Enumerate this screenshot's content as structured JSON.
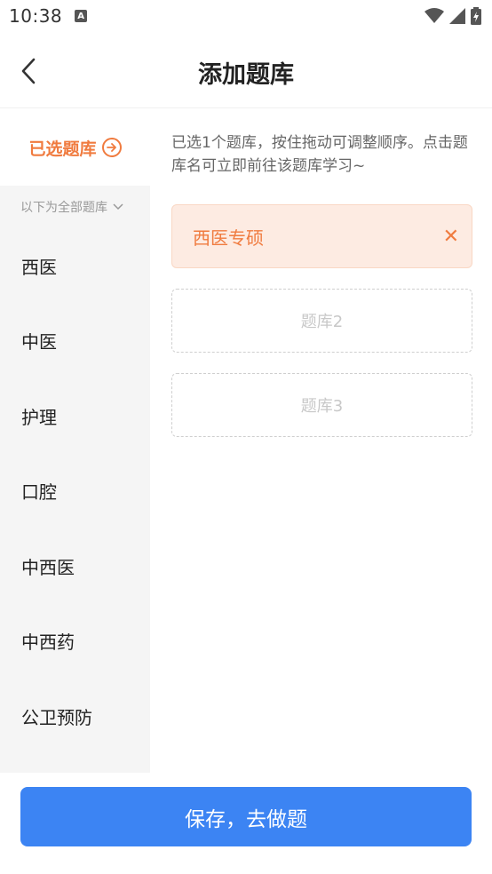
{
  "status_bar": {
    "time": "10:38",
    "notification_badge": "A"
  },
  "header": {
    "title": "添加题库"
  },
  "sidebar": {
    "selected_label": "已选题库",
    "all_label": "以下为全部题库",
    "items": [
      {
        "label": "西医"
      },
      {
        "label": "中医"
      },
      {
        "label": "护理"
      },
      {
        "label": "口腔"
      },
      {
        "label": "中西医"
      },
      {
        "label": "中西药"
      },
      {
        "label": "公卫预防"
      }
    ]
  },
  "main": {
    "hint_line1": "已选1个题库，按住拖动可调整顺序。点击题",
    "hint_line2": "库名可立即前往该题库学习~",
    "selected": [
      {
        "name": "西医专硕"
      }
    ],
    "empty_slots": [
      {
        "label": "题库2"
      },
      {
        "label": "题库3"
      }
    ]
  },
  "footer": {
    "save_label": "保存，去做题"
  },
  "colors": {
    "accent": "#f07b3f",
    "primary": "#3c84f3",
    "sidebar_bg": "#f5f5f5"
  }
}
